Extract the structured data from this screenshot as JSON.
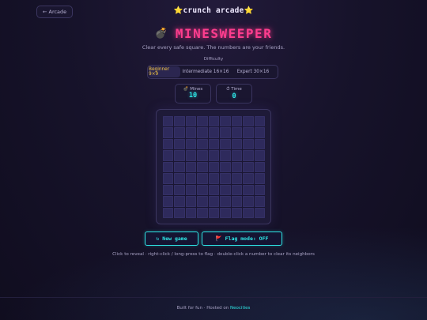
{
  "header": {
    "back_label": "← Arcade",
    "star_left": "⭐",
    "site_title": "crunch arcade",
    "star_right": "⭐"
  },
  "game": {
    "icon": "💣",
    "title": "MINESWEEPER",
    "subtitle": "Clear every safe square. The numbers are your friends."
  },
  "difficulty": {
    "label": "Difficulty",
    "options": [
      "Beginner 9×9",
      "Intermediate 16×16",
      "Expert 30×16"
    ],
    "selected": "Beginner 9×9"
  },
  "stats": {
    "mines_label": "💣 Mines",
    "mines_value": "10",
    "time_label": "⏱ Time",
    "time_value": "0"
  },
  "board": {
    "rows": 9,
    "cols": 9,
    "state": "all-hidden"
  },
  "controls": {
    "new_game_icon": "↻",
    "new_game_label": "New game",
    "flag_icon": "🚩",
    "flag_label": "Flag mode: OFF"
  },
  "help_text": "Click to reveal · right-click / long-press to flag · double-click a number to clear its neighbors",
  "footer": {
    "text": "Built for fun · Hosted on ",
    "link": "Neocities"
  },
  "colors": {
    "accent_pink": "#ff3d8e",
    "accent_cyan": "#2ee6e6",
    "accent_gold": "#f4c542",
    "cell_hidden": "#2e2a5c",
    "background": "#17132b"
  }
}
